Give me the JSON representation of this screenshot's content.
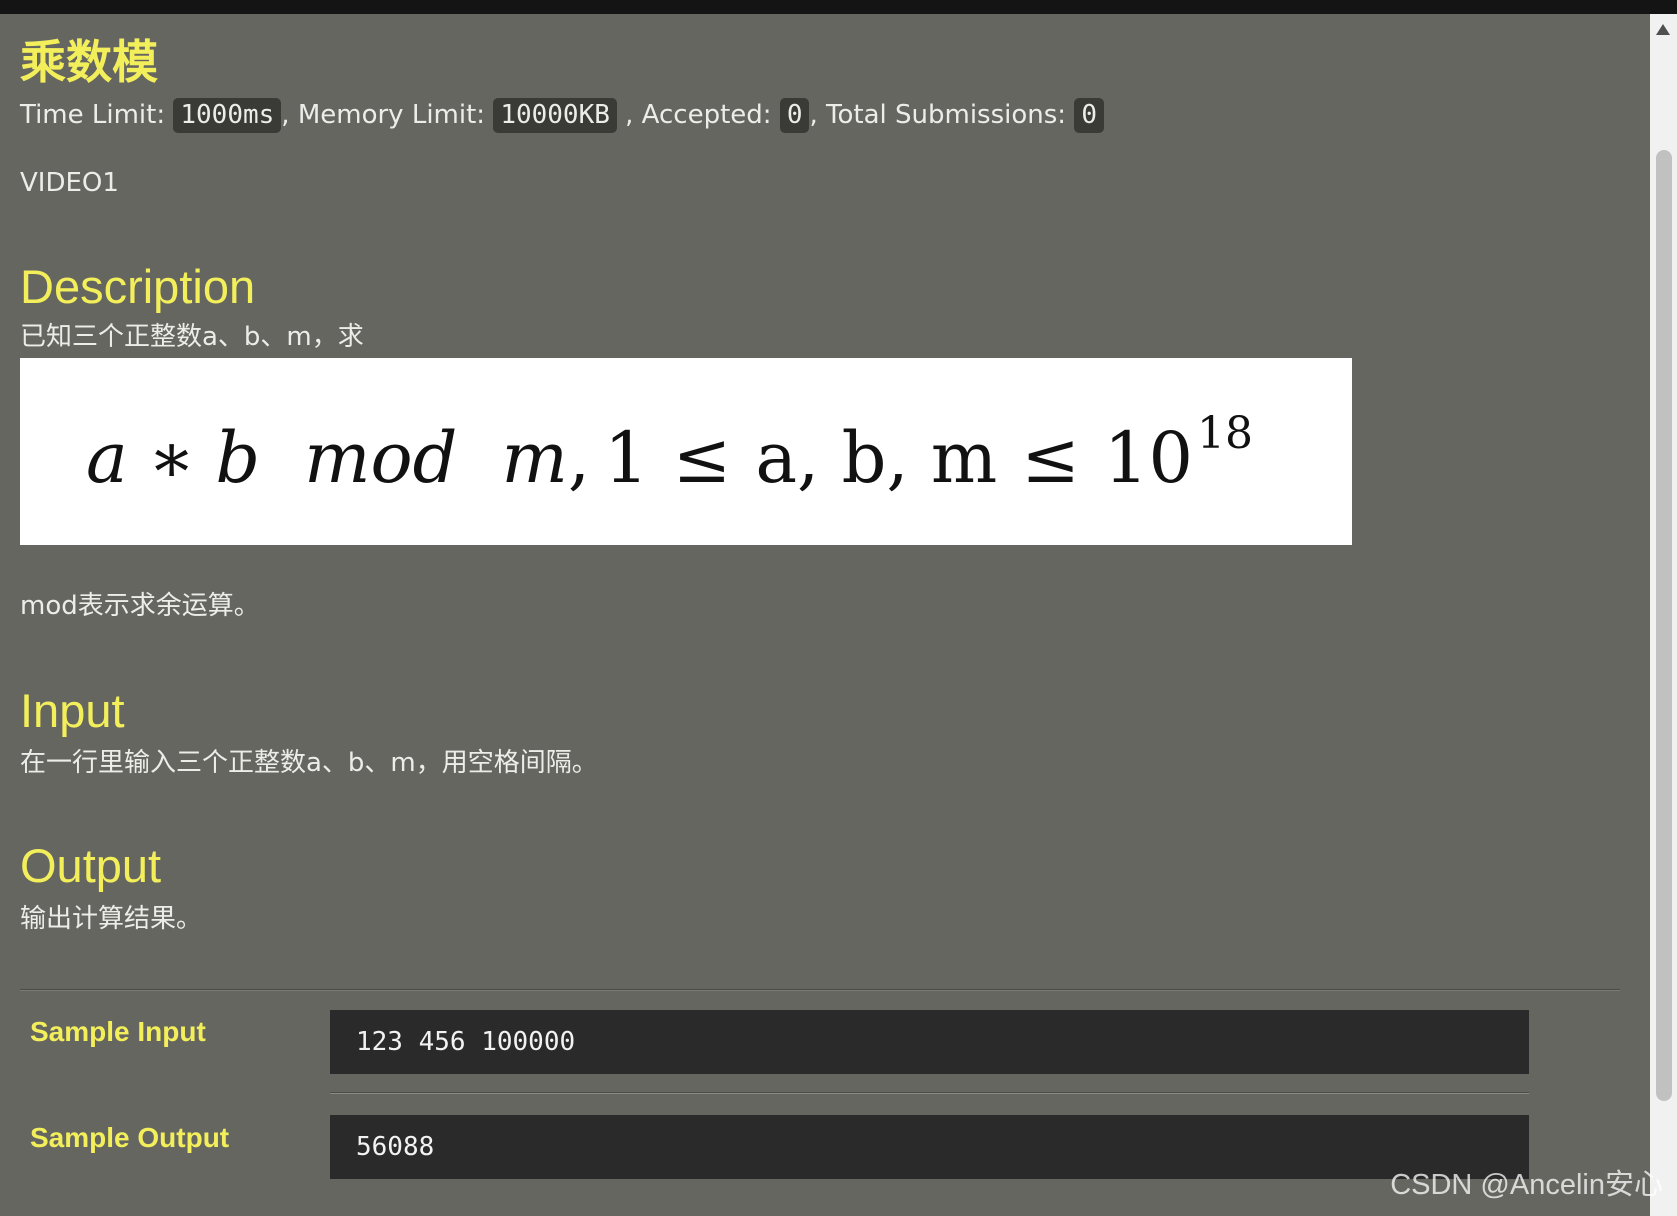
{
  "colors": {
    "page_background": "#666661",
    "heading_yellow": "#f3ef5b",
    "body_text": "#ecece8",
    "badge_background": "#3a3a37",
    "sample_box_background": "#2a2a2a"
  },
  "problem": {
    "title": "乘数模",
    "limits": {
      "time_label": "Time Limit: ",
      "time_value": "1000ms",
      "memory_label": ", Memory Limit: ",
      "memory_value": "10000KB",
      "accepted_label": " , Accepted: ",
      "accepted_value": "0",
      "submissions_label": ", Total Submissions: ",
      "submissions_value": "0"
    },
    "source": "VIDEO1"
  },
  "description": {
    "heading": "Description",
    "intro": "已知三个正整数a、b、m，求",
    "formula_tokens": [
      "a",
      "∗",
      "b",
      "mod",
      "m",
      ",",
      "1",
      "≤",
      "a, b, m",
      "≤",
      "10",
      "18"
    ],
    "note": "mod表示求余运算。"
  },
  "input_section": {
    "heading": "Input",
    "text": "在一行里输入三个正整数a、b、m，用空格间隔。"
  },
  "output_section": {
    "heading": "Output",
    "text": "输出计算结果。"
  },
  "samples": {
    "input_label": "Sample Input",
    "input_value": "123 456 100000",
    "output_label": "Sample Output",
    "output_value": "56088"
  },
  "scrollbar": {
    "up_icon": "triangle-up-icon"
  },
  "watermark": "CSDN @Ancelin安心"
}
